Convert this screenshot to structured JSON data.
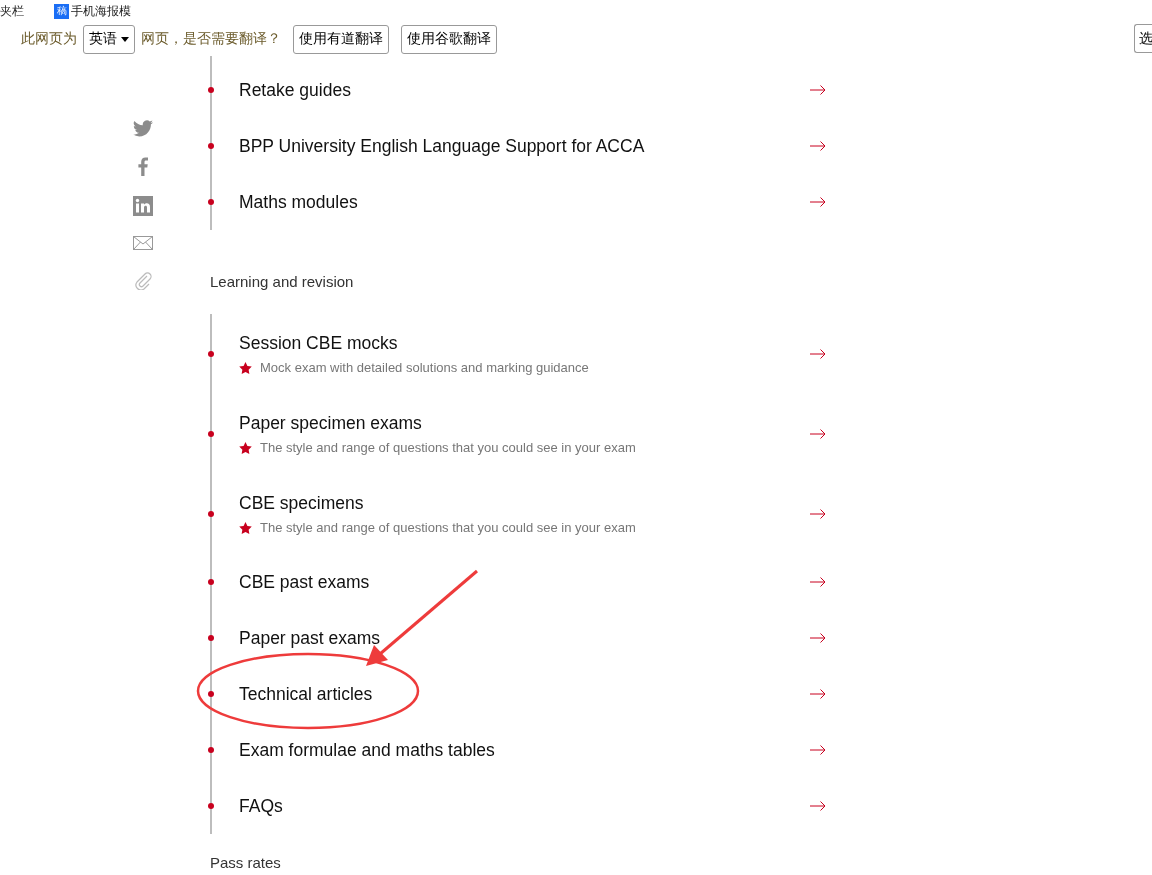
{
  "bookmarks_bar": [
    {
      "label": "夹栏"
    },
    {
      "label": "手机海报模",
      "icon_text": "稿"
    }
  ],
  "translate_bar": {
    "prompt_before": "此网页为",
    "language": "英语",
    "prompt_after": "网页，是否需要翻译？",
    "buttons": [
      "使用有道翻译",
      "使用谷歌翻译"
    ],
    "right_button": "选"
  },
  "sections": [
    {
      "items": [
        {
          "title": "Retake guides"
        },
        {
          "title": "BPP University English Language Support for ACCA"
        },
        {
          "title": "Maths modules"
        }
      ]
    },
    {
      "heading": "Learning and revision",
      "items": [
        {
          "title": "Session CBE mocks",
          "description": "Mock exam with detailed solutions and marking guidance"
        },
        {
          "title": "Paper specimen exams",
          "description": "The style and range of questions that you could see in your exam"
        },
        {
          "title": "CBE specimens",
          "description": "The style and range of questions that you could see in your exam"
        },
        {
          "title": "CBE past exams"
        },
        {
          "title": "Paper past exams"
        },
        {
          "title": "Technical articles"
        },
        {
          "title": "Exam formulae and maths tables"
        },
        {
          "title": "FAQs"
        }
      ]
    },
    {
      "heading": "Pass rates"
    }
  ]
}
